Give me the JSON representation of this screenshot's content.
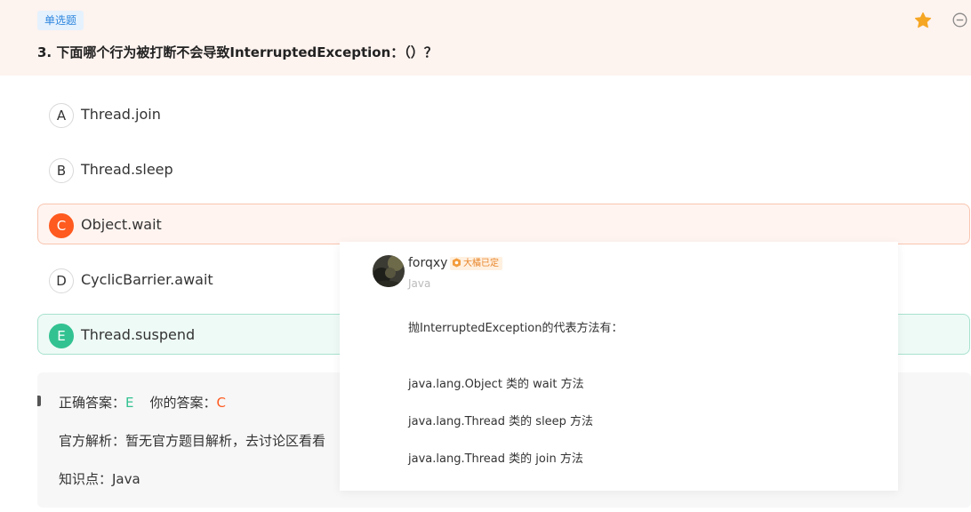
{
  "question": {
    "tag": "单选题",
    "title": "3. 下面哪个行为被打断不会导致InterruptedException：（）？"
  },
  "header_icons": {
    "favorite": "star-icon",
    "collapse": "minus-circle-icon",
    "favorite_color": "#f5a623"
  },
  "options": [
    {
      "letter": "A",
      "text": "Thread.join",
      "state": "normal"
    },
    {
      "letter": "B",
      "text": "Thread.sleep",
      "state": "normal"
    },
    {
      "letter": "C",
      "text": "Object.wait",
      "state": "wrong"
    },
    {
      "letter": "D",
      "text": "CyclicBarrier.await",
      "state": "normal"
    },
    {
      "letter": "E",
      "text": "Thread.suspend",
      "state": "correct"
    }
  ],
  "analysis": {
    "correct_label": "正确答案：",
    "correct_value": "E",
    "your_label": "你的答案：",
    "your_value": "C",
    "official": "官方解析：暂无官方题目解析，去讨论区看看",
    "knowledge": "知识点：Java"
  },
  "popup": {
    "username": "forqxy",
    "badge": "大橘已定",
    "subtitle": "Java",
    "intro": "抛InterruptedException的代表方法有：",
    "lines": [
      "java.lang.Object 类的 wait 方法",
      "java.lang.Thread 类的 sleep 方法",
      "java.lang.Thread 类的 join 方法"
    ]
  },
  "colors": {
    "wrong": "#ff5a1f",
    "correct": "#32c291",
    "header_bg": "#fdf3ef",
    "tag": "#2e86de"
  }
}
